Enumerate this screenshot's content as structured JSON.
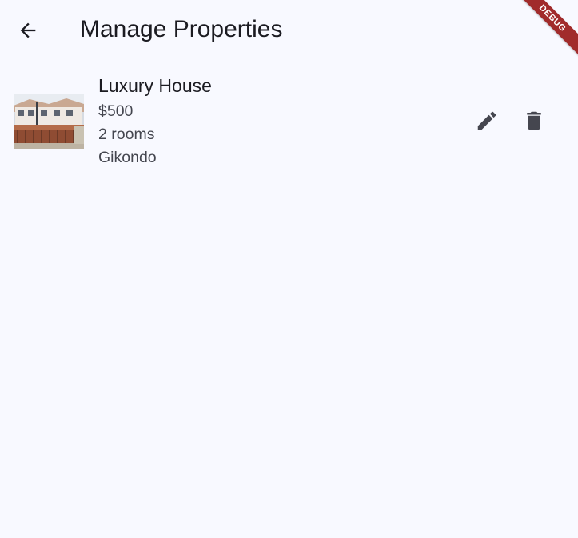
{
  "app_bar": {
    "title": "Manage Properties",
    "back_icon": "arrow-back-icon"
  },
  "debug_banner": {
    "label": "DEBUG",
    "color": "#a12b2b"
  },
  "properties": [
    {
      "name": "Luxury House",
      "price": "$500",
      "rooms": "2 rooms",
      "location": "Gikondo",
      "thumbnail_icon": "house-photo",
      "edit_icon": "edit-icon",
      "delete_icon": "delete-icon"
    }
  ],
  "colors": {
    "background": "#f8f9ff",
    "text_primary": "#1b1b21",
    "text_secondary": "#44464f",
    "icon": "#45464f"
  }
}
